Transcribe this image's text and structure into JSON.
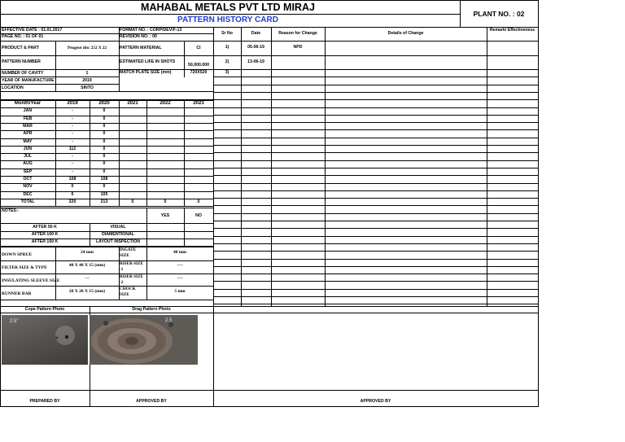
{
  "header": {
    "company": "MAHABAL METALS PVT LTD MIRAJ",
    "card_title": "PATTERN HISTORY CARD",
    "plant": "PLANT NO. : 02"
  },
  "meta": {
    "effective_date": "EFFECTIVE DATE : 01.01.2017",
    "page_no": "PAGE NO. : 01 OF 01",
    "format_no": "FORMAT NO. : CORP/DEV/F-13",
    "revision_no": "REVISION NO. : 00"
  },
  "info": {
    "product_label": "PRODUCT & PART",
    "product_value": "Peugeot disc 252 X 22",
    "pattern_number_label": "PATTERN NUMBER",
    "pattern_number_value": "",
    "cavity_label": "NUMBER OF CAVITY",
    "cavity_value": "1",
    "year_label": "YEAR OF MANUFACTURE",
    "year_value": "2019",
    "location_label": "LOCATION",
    "location_value": "SINTO",
    "material_label": "PATTERN MATERIAL",
    "material_value": "CI",
    "life_label": "ESTIMATED LIFE IN SHOTS",
    "life_value": "50,000.000",
    "plate_label": "MATCH PLATE SIZE (mm)",
    "plate_value": "720X520"
  },
  "production": {
    "headers": [
      "Month/Year",
      "2019",
      "2020",
      "2021",
      "2022",
      "2023"
    ],
    "rows": [
      [
        "JAN",
        "-",
        "0",
        "",
        "",
        ""
      ],
      [
        "FEB",
        "-",
        "0",
        "",
        "",
        ""
      ],
      [
        "MAR",
        "-",
        "0",
        "",
        "",
        ""
      ],
      [
        "APR",
        "-",
        "0",
        "",
        "",
        ""
      ],
      [
        "MAY",
        "-",
        "0",
        "",
        "",
        ""
      ],
      [
        "JUN",
        "112",
        "0",
        "",
        "",
        ""
      ],
      [
        "JUL",
        "-",
        "0",
        "",
        "",
        ""
      ],
      [
        "AUG",
        "-",
        "0",
        "",
        "",
        ""
      ],
      [
        "SEP",
        "-",
        "0",
        "",
        "",
        ""
      ],
      [
        "OCT",
        "108",
        "108",
        "",
        "",
        ""
      ],
      [
        "NOV",
        "0",
        "0",
        "",
        "",
        ""
      ],
      [
        "DEC",
        "0",
        "105",
        "",
        "",
        ""
      ],
      [
        "TOTAL",
        "220",
        "213",
        "0",
        "0",
        "0"
      ]
    ]
  },
  "notes": {
    "label": "NOTES:-",
    "yes": "YES",
    "no": "NO",
    "checks": [
      [
        "AFTER 50 K",
        "VISUAL"
      ],
      [
        "AFTER 100 K",
        "DIAMENTIONAL"
      ],
      [
        "AFTER 150 K",
        "LAYOUT INSPECTION"
      ]
    ]
  },
  "gating": [
    {
      "label": "DOWN SPRUE",
      "value": "24 mm",
      "label2": "INGATE SIZE",
      "value2": "40 mm"
    },
    {
      "label": "FILTER SIZE & TYPE",
      "value": "40 X 40 X 15 (mm)",
      "label2": "RISER SIZE -1",
      "value2": "----"
    },
    {
      "label": "INSULATING SLEEVE SIZE",
      "value": "---",
      "label2": "RISER SIZE -2",
      "value2": "----"
    },
    {
      "label": "RUNNER BAR",
      "value": "20 X 20 X 15 (mm)",
      "label2": "CHOCK SIZE",
      "value2": "5 mm"
    }
  ],
  "photos": {
    "cope_label": "Cope Pattern Photo",
    "drag_label": "Drag Pattern Photo",
    "cope_mark": "2.5\"",
    "drag_mark": "2.5"
  },
  "history": {
    "headers": [
      "Sr No",
      "Date",
      "Reason for Change",
      "Details of Change",
      "Remark/ Effectiveness"
    ],
    "rows": [
      [
        "1)",
        "05-06-19",
        "NPD",
        "",
        ""
      ],
      [
        "2)",
        "13-06-19",
        "",
        "",
        ""
      ],
      [
        "3)",
        "",
        "",
        "",
        ""
      ]
    ]
  },
  "footer": {
    "prepared_by": "PREPARED BY",
    "approved_by_left": "APPROVED BY",
    "approved_by_right": "APPROVED BY"
  },
  "colors": {
    "title_blue": "#1f3dd6"
  }
}
